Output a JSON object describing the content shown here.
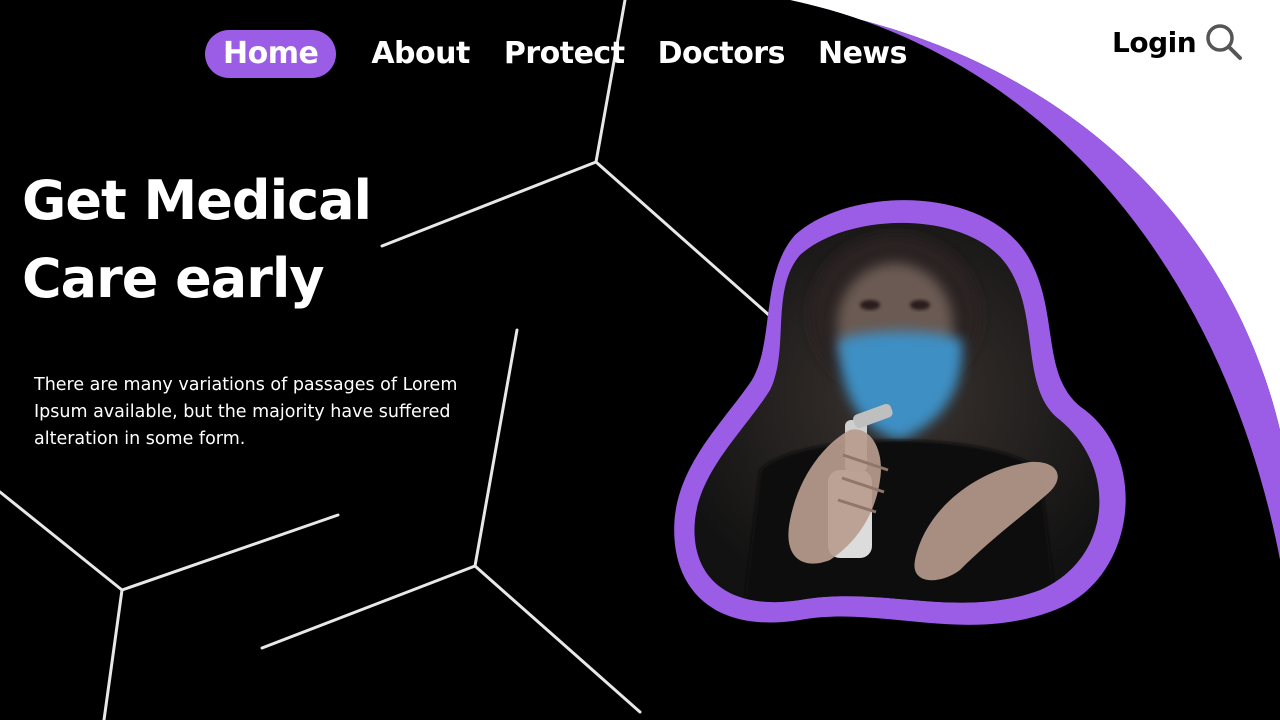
{
  "nav": {
    "items": [
      {
        "label": "Home",
        "active": true
      },
      {
        "label": "About",
        "active": false
      },
      {
        "label": "Protect",
        "active": false
      },
      {
        "label": "Doctors",
        "active": false
      },
      {
        "label": "News",
        "active": false
      }
    ]
  },
  "header": {
    "login_label": "Login",
    "search_icon": "search-icon"
  },
  "hero": {
    "headline_line1": "Get Medical",
    "headline_line2": "Care early",
    "body": "There are many variations of passages of Lorem Ipsum available, but the majority have suffered alteration in some form."
  },
  "colors": {
    "background": "#000000",
    "accent": "#9b5de5",
    "text_light": "#ffffff",
    "text_dark": "#000000"
  },
  "image": {
    "subject": "person-wearing-face-mask-using-hand-sanitizer-spray"
  }
}
